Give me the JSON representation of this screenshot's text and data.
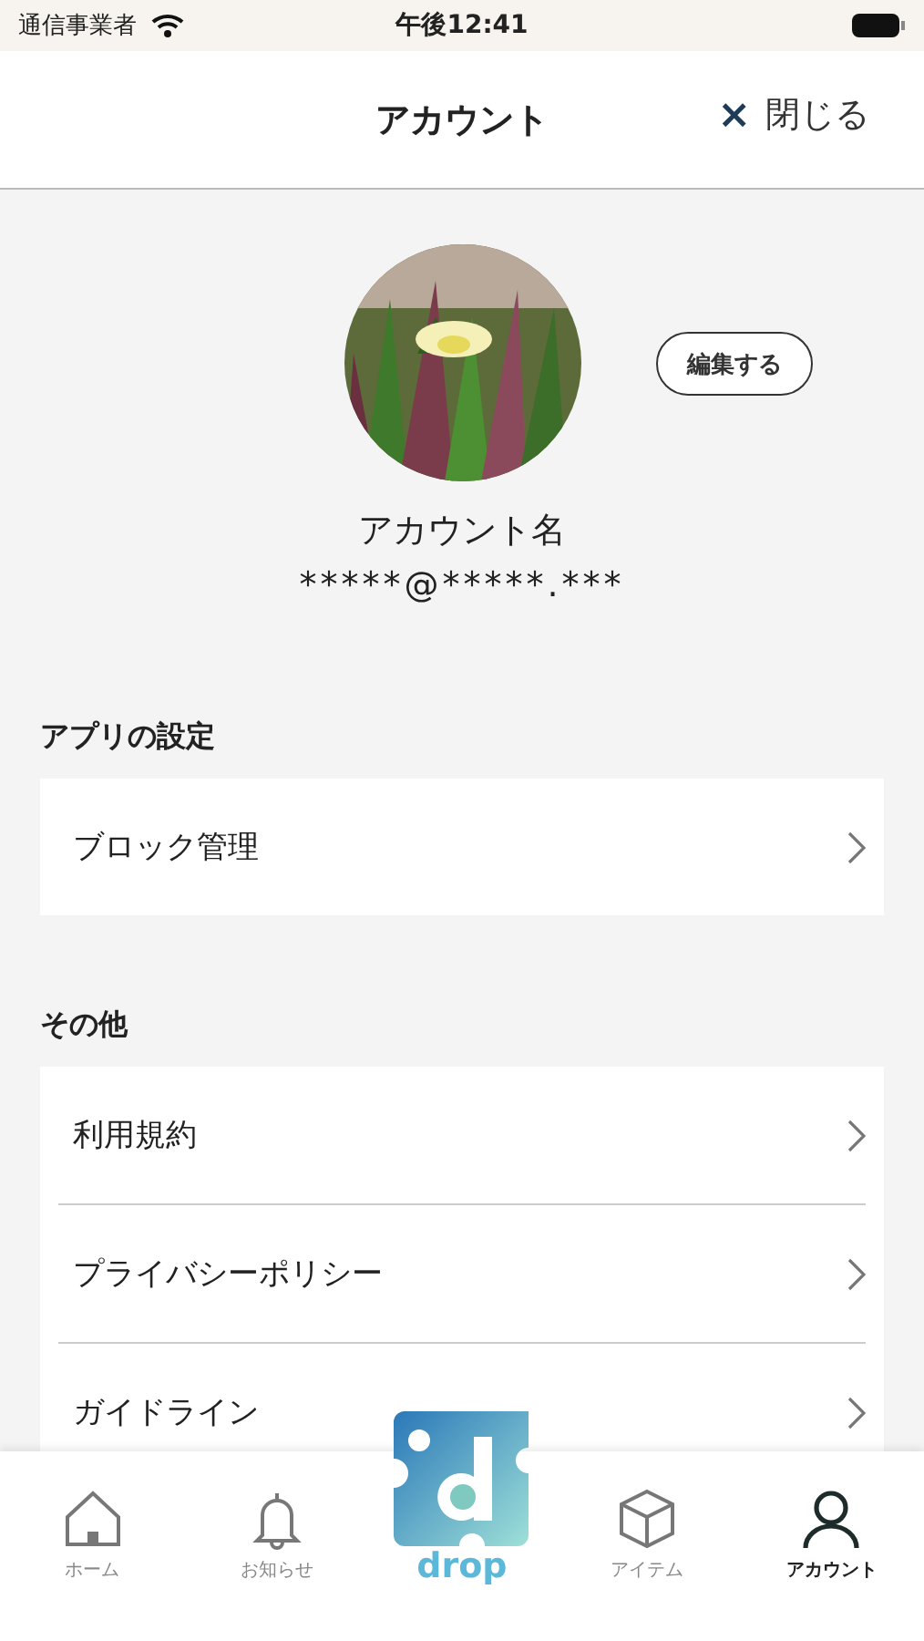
{
  "status_bar": {
    "carrier": "通信事業者",
    "time": "午後12:41"
  },
  "header": {
    "title": "アカウント",
    "close": {
      "icon": "×",
      "label": "閉じる"
    }
  },
  "profile": {
    "edit_button": "編集する",
    "name": "アカウント名",
    "email": "*****@*****.***"
  },
  "sections": [
    {
      "title": "アプリの設定",
      "items": [
        "ブロック管理"
      ]
    },
    {
      "title": "その他",
      "items": [
        "利用規約",
        "プライバシーポリシー",
        "ガイドライン"
      ]
    }
  ],
  "tab_bar": [
    {
      "kind": "home",
      "label": "ホーム",
      "selected": false
    },
    {
      "kind": "bell",
      "label": "お知らせ",
      "selected": false
    },
    {
      "kind": "logo",
      "label": "drop",
      "selected": false
    },
    {
      "kind": "box",
      "label": "アイテム",
      "selected": false
    },
    {
      "kind": "person",
      "label": "アカウント",
      "selected": true
    }
  ]
}
